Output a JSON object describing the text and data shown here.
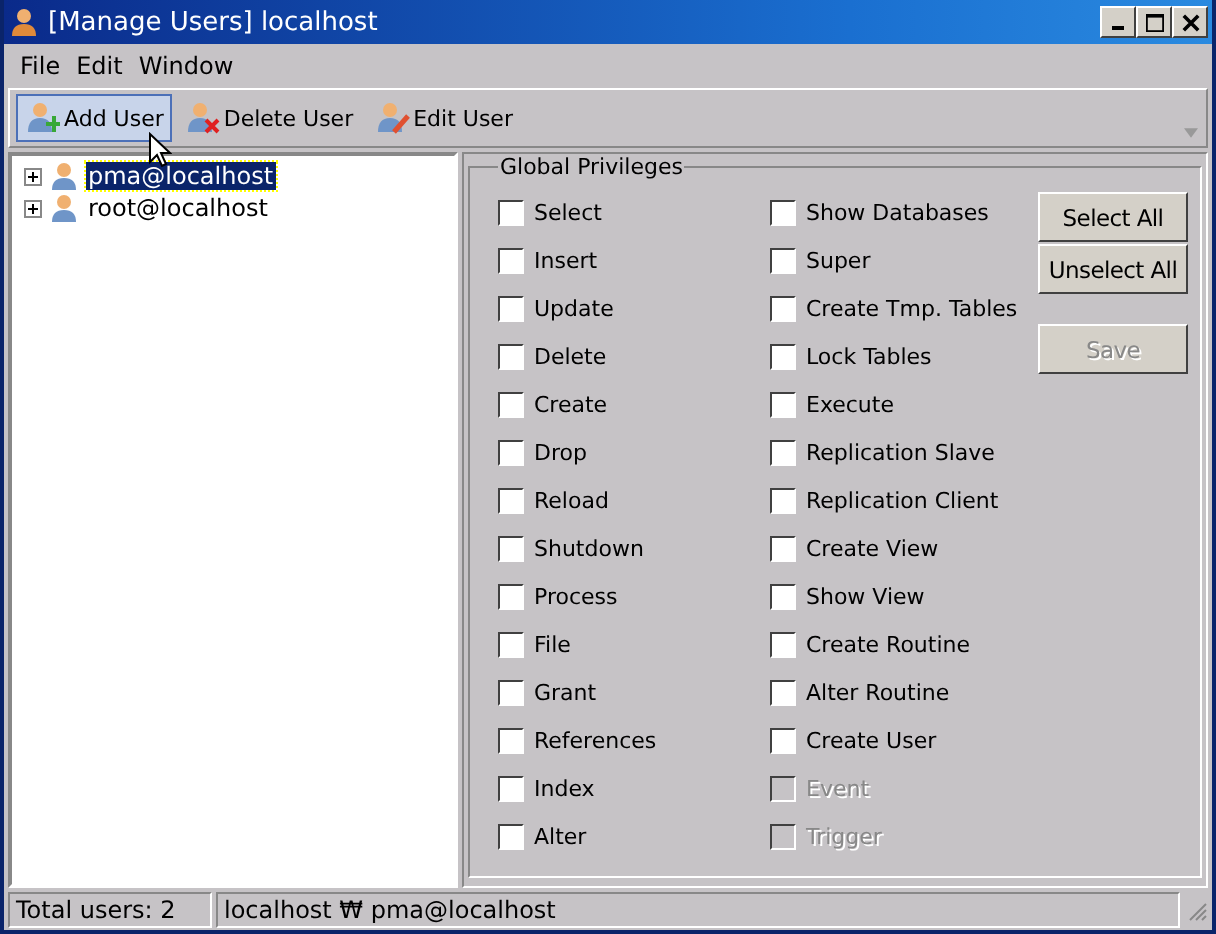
{
  "window": {
    "title": "[Manage Users] localhost"
  },
  "menu": [
    "File",
    "Edit",
    "Window"
  ],
  "toolbar": [
    {
      "label": "Add User",
      "kind": "add",
      "selected": true
    },
    {
      "label": "Delete User",
      "kind": "delete",
      "selected": false
    },
    {
      "label": "Edit User",
      "kind": "edit",
      "selected": false
    }
  ],
  "users": [
    {
      "label": "pma@localhost",
      "selected": true,
      "expanded": false
    },
    {
      "label": "root@localhost",
      "selected": false,
      "expanded": false
    }
  ],
  "privileges": {
    "title": "Global Privileges",
    "columns": [
      [
        {
          "label": "Select",
          "checked": false,
          "disabled": false
        },
        {
          "label": "Insert",
          "checked": false,
          "disabled": false
        },
        {
          "label": "Update",
          "checked": false,
          "disabled": false
        },
        {
          "label": "Delete",
          "checked": false,
          "disabled": false
        },
        {
          "label": "Create",
          "checked": false,
          "disabled": false
        },
        {
          "label": "Drop",
          "checked": false,
          "disabled": false
        },
        {
          "label": "Reload",
          "checked": false,
          "disabled": false
        },
        {
          "label": "Shutdown",
          "checked": false,
          "disabled": false
        },
        {
          "label": "Process",
          "checked": false,
          "disabled": false
        },
        {
          "label": "File",
          "checked": false,
          "disabled": false
        },
        {
          "label": "Grant",
          "checked": false,
          "disabled": false
        },
        {
          "label": "References",
          "checked": false,
          "disabled": false
        },
        {
          "label": "Index",
          "checked": false,
          "disabled": false
        },
        {
          "label": "Alter",
          "checked": false,
          "disabled": false
        }
      ],
      [
        {
          "label": "Show Databases",
          "checked": false,
          "disabled": false
        },
        {
          "label": "Super",
          "checked": false,
          "disabled": false
        },
        {
          "label": "Create Tmp. Tables",
          "checked": false,
          "disabled": false
        },
        {
          "label": "Lock Tables",
          "checked": false,
          "disabled": false
        },
        {
          "label": "Execute",
          "checked": false,
          "disabled": false
        },
        {
          "label": "Replication Slave",
          "checked": false,
          "disabled": false
        },
        {
          "label": "Replication Client",
          "checked": false,
          "disabled": false
        },
        {
          "label": "Create View",
          "checked": false,
          "disabled": false
        },
        {
          "label": "Show View",
          "checked": false,
          "disabled": false
        },
        {
          "label": "Create Routine",
          "checked": false,
          "disabled": false
        },
        {
          "label": "Alter Routine",
          "checked": false,
          "disabled": false
        },
        {
          "label": "Create User",
          "checked": false,
          "disabled": false
        },
        {
          "label": "Event",
          "checked": false,
          "disabled": true
        },
        {
          "label": "Trigger",
          "checked": false,
          "disabled": true
        }
      ]
    ]
  },
  "buttons": [
    {
      "label": "Select All",
      "disabled": false
    },
    {
      "label": "Unselect All",
      "disabled": false
    },
    {
      "label": "Save",
      "disabled": true
    }
  ],
  "status_bar": [
    "Total users: 2",
    "localhost ₩ pma@localhost"
  ]
}
